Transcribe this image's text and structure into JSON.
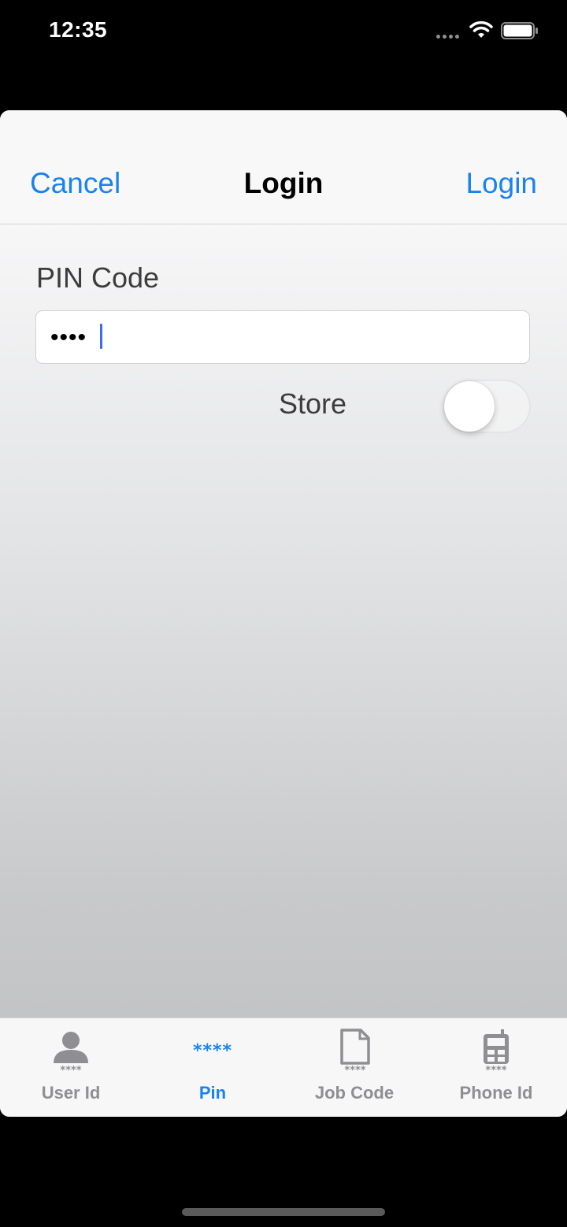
{
  "status_bar": {
    "time": "12:35"
  },
  "nav": {
    "cancel_label": "Cancel",
    "title": "Login",
    "login_label": "Login"
  },
  "form": {
    "pin_label": "PIN Code",
    "pin_value_masked": "••••",
    "store_label": "Store",
    "store_enabled": false
  },
  "tabs": [
    {
      "label": "User Id",
      "icon": "user-icon",
      "active": false
    },
    {
      "label": "Pin",
      "icon": "pin-icon",
      "active": true
    },
    {
      "label": "Job Code",
      "icon": "document-icon",
      "active": false
    },
    {
      "label": "Phone Id",
      "icon": "phone-icon",
      "active": false
    }
  ],
  "colors": {
    "accent": "#1a82f0",
    "inactive_tab": "#8e8e93",
    "caret": "#3d6cf4"
  }
}
